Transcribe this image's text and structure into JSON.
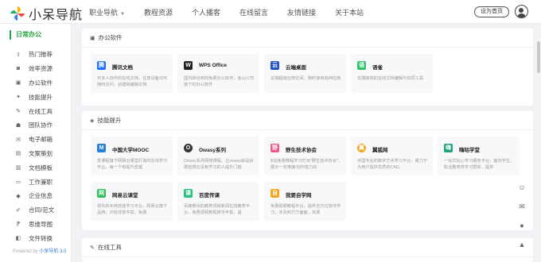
{
  "header": {
    "logo_text": "小呆导航",
    "nav": [
      "职业导航",
      "教程资源",
      "个人播客",
      "在线留言",
      "友情链接",
      "关于本站"
    ],
    "homepage_button": "设为首页"
  },
  "sidebar": {
    "heading": "日常办公",
    "items": [
      {
        "label": "热门推荐",
        "icon": "upload-icon"
      },
      {
        "label": "效率资源",
        "icon": "car-icon"
      },
      {
        "label": "办公软件",
        "icon": "image-icon"
      },
      {
        "label": "技能提升",
        "icon": "star-icon"
      },
      {
        "label": "在线工具",
        "icon": "wrench-icon"
      },
      {
        "label": "团队协作",
        "icon": "team-icon"
      },
      {
        "label": "电子邮箱",
        "icon": "mail-icon"
      },
      {
        "label": "文案策划",
        "icon": "pen-icon"
      },
      {
        "label": "文档模板",
        "icon": "document-icon"
      },
      {
        "label": "工作兼职",
        "icon": "monitor-icon"
      },
      {
        "label": "企业信息",
        "icon": "building-icon"
      },
      {
        "label": "合同/范文",
        "icon": "contract-icon"
      },
      {
        "label": "思维导图",
        "icon": "mindmap-icon"
      },
      {
        "label": "文件转换",
        "icon": "convert-icon"
      }
    ],
    "powered_prefix": "Powered by ",
    "powered_link": "小呆导航 3.0"
  },
  "sections": [
    {
      "title": "办公软件",
      "cards": [
        {
          "name": "腾讯文档",
          "desc": "可多人协作的在线文档，任意设备均可随时访问，创建和编辑文档",
          "color": "#1e6fff",
          "glyph": "腾"
        },
        {
          "name": "WPS Office",
          "desc": "国内转坯用的免费办公软件，金山公司旗下的办公软件",
          "color": "#222222",
          "glyph": "W"
        },
        {
          "name": "云端桌面",
          "desc": "云端超级应用空间，随时使用各种应用",
          "color": "#2253c5",
          "glyph": "云"
        },
        {
          "name": "语雀",
          "desc": "优雅高效的在线文档编辑与协同工具",
          "color": "#31c26a",
          "glyph": "语"
        }
      ]
    },
    {
      "title": "技能提升",
      "cards": [
        {
          "name": "中国大学MOOC",
          "desc": "爱课程旗下网易云课堂打造的在线学习平台。每一个有提升愿望",
          "color": "#2b7fd6",
          "glyph": "M"
        },
        {
          "name": "Owasy系列",
          "desc": "Owasy系列网络课程。让owasy就是给那些想在没有学习的人提升门槛",
          "color": "#333333",
          "glyph": "O"
        },
        {
          "name": "野生技术协会",
          "desc": "B站免费教程学习栏目“野生技术协会”，展示一定难度/创作能力的",
          "color": "#e85a8a",
          "glyph": "野"
        },
        {
          "name": "翼狐网",
          "desc": "中国专业的数字艺术学习平台，致力于为用户提供优质的CAD、",
          "color": "#f0a81c",
          "glyph": "翼"
        },
        {
          "name": "嗨咕学堂",
          "desc": "一站式帖心学习服务平台，面向学生、职业教育类学习群体，提供",
          "color": "#1aa37a",
          "glyph": "嗨"
        },
        {
          "name": "网易云课堂",
          "desc": "领先的实用技能学习平台，网易云旗下品牌，内容非常丰富，免费",
          "color": "#2fbf5a",
          "glyph": "网"
        },
        {
          "name": "百度传课",
          "desc": "百度推出的教育领域新闻在线教育平台，免费视频教程搜寻丰富，基",
          "color": "#27c07c",
          "glyph": "课"
        },
        {
          "name": "我要自学网",
          "desc": "免费视频教程平台，提供全方位软件学习，涉及到方方面面，资源",
          "color": "#f3a51b",
          "glyph": "自"
        }
      ]
    },
    {
      "title": "在线工具",
      "cards": []
    }
  ],
  "right_tools": [
    "smile-icon",
    "mail-icon",
    "chat-icon",
    "arrow-up-icon"
  ]
}
